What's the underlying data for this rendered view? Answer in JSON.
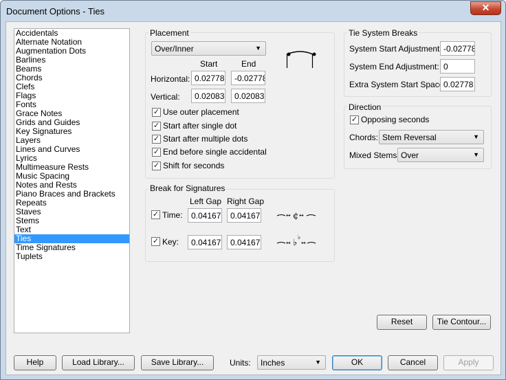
{
  "window": {
    "title": "Document Options - Ties",
    "close_label": "✕"
  },
  "categories": [
    {
      "label": "Accidentals"
    },
    {
      "label": "Alternate Notation"
    },
    {
      "label": "Augmentation Dots"
    },
    {
      "label": "Barlines"
    },
    {
      "label": "Beams"
    },
    {
      "label": "Chords"
    },
    {
      "label": "Clefs"
    },
    {
      "label": "Flags"
    },
    {
      "label": "Fonts"
    },
    {
      "label": "Grace Notes"
    },
    {
      "label": "Grids and Guides"
    },
    {
      "label": "Key Signatures"
    },
    {
      "label": "Layers"
    },
    {
      "label": "Lines and Curves"
    },
    {
      "label": "Lyrics"
    },
    {
      "label": "Multimeasure Rests"
    },
    {
      "label": "Music Spacing"
    },
    {
      "label": "Notes and Rests"
    },
    {
      "label": "Piano Braces and Brackets"
    },
    {
      "label": "Repeats"
    },
    {
      "label": "Staves"
    },
    {
      "label": "Stems"
    },
    {
      "label": "Text"
    },
    {
      "label": "Ties",
      "selected": true
    },
    {
      "label": "Time Signatures"
    },
    {
      "label": "Tuplets"
    }
  ],
  "placement": {
    "title": "Placement",
    "dropdown": "Over/Inner",
    "start_header": "Start",
    "end_header": "End",
    "horizontal_label": "Horizontal:",
    "horizontal_start": "0.02778",
    "horizontal_end": "-0.02778",
    "vertical_label": "Vertical:",
    "vertical_start": "0.02083",
    "vertical_end": "0.02083",
    "checks": [
      {
        "label": "Use outer placement",
        "checked": true
      },
      {
        "label": "Start after single dot",
        "checked": true
      },
      {
        "label": "Start after multiple dots",
        "checked": true
      },
      {
        "label": "End before single accidental",
        "checked": true
      },
      {
        "label": "Shift for seconds",
        "checked": true
      }
    ]
  },
  "break_signatures": {
    "title": "Break for Signatures",
    "left_gap_header": "Left Gap",
    "right_gap_header": "Right Gap",
    "time_label": "Time:",
    "time_checked": true,
    "time_left": "0.04167",
    "time_right": "0.04167",
    "key_label": "Key:",
    "key_checked": true,
    "key_left": "0.04167",
    "key_right": "0.04167"
  },
  "system_breaks": {
    "title": "Tie System Breaks",
    "start_label": "System Start Adjustment:",
    "start_value": "-0.02778",
    "end_label": "System End Adjustment:",
    "end_value": "0",
    "extra_label": "Extra System Start Space:",
    "extra_value": "0.02778"
  },
  "direction": {
    "title": "Direction",
    "opposing_label": "Opposing seconds",
    "opposing_checked": true,
    "chords_label": "Chords:",
    "chords_value": "Stem Reversal",
    "mixed_label": "Mixed Stems:",
    "mixed_value": "Over"
  },
  "buttons": {
    "reset": "Reset",
    "tie_contour": "Tie Contour...",
    "help": "Help",
    "load_library": "Load Library...",
    "save_library": "Save Library...",
    "units_label": "Units:",
    "units_value": "Inches",
    "ok": "OK",
    "cancel": "Cancel",
    "apply": "Apply"
  },
  "accent_colors": {
    "selection": "#3399ff",
    "close_button": "#c74a33",
    "title_bar": "#c9d9ea"
  }
}
